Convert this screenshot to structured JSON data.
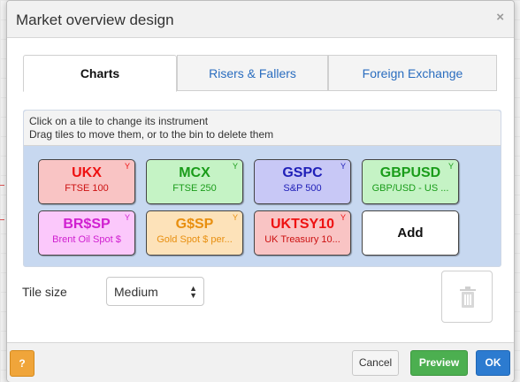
{
  "dialog": {
    "title": "Market overview design",
    "close_glyph": "×"
  },
  "tabs": [
    {
      "label": "Charts",
      "active": true
    },
    {
      "label": "Risers & Fallers",
      "active": false
    },
    {
      "label": "Foreign Exchange",
      "active": false
    }
  ],
  "instructions": {
    "line1": "Click on a tile to change its instrument",
    "line2": "Drag tiles to move them, or to the bin to delete them"
  },
  "tiles": [
    {
      "code": "UKX",
      "name": "FTSE 100",
      "tag": "Y",
      "color": "red"
    },
    {
      "code": "MCX",
      "name": "FTSE 250",
      "tag": "Y",
      "color": "green"
    },
    {
      "code": "GSPC",
      "name": "S&P 500",
      "tag": "Y",
      "color": "blue"
    },
    {
      "code": "GBPUSD",
      "name": "GBP/USD - US ...",
      "tag": "Y",
      "color": "green"
    },
    {
      "code": "BR$SP",
      "name": "Brent Oil Spot $",
      "tag": "Y",
      "color": "magenta"
    },
    {
      "code": "G$SP",
      "name": "Gold Spot $ per...",
      "tag": "Y",
      "color": "orange"
    },
    {
      "code": "UKTSY10",
      "name": "UK Treasury 10...",
      "tag": "Y",
      "color": "red"
    }
  ],
  "add_tile": {
    "label": "Add"
  },
  "tile_size": {
    "label": "Tile size",
    "selected": "Medium"
  },
  "bin": {
    "icon": "trash-icon"
  },
  "footer": {
    "help_label": "?",
    "cancel_label": "Cancel",
    "preview_label": "Preview",
    "ok_label": "OK"
  },
  "colors": {
    "red": "#f9c4c4",
    "green": "#c5f3c5",
    "blue": "#c8c8f6",
    "magenta": "#fbc8fb",
    "orange": "#fde2b9",
    "panel": "#c7d8f0",
    "ok_button": "#2c7bd0",
    "preview_button": "#4caf50",
    "help_button": "#f0a53a"
  }
}
